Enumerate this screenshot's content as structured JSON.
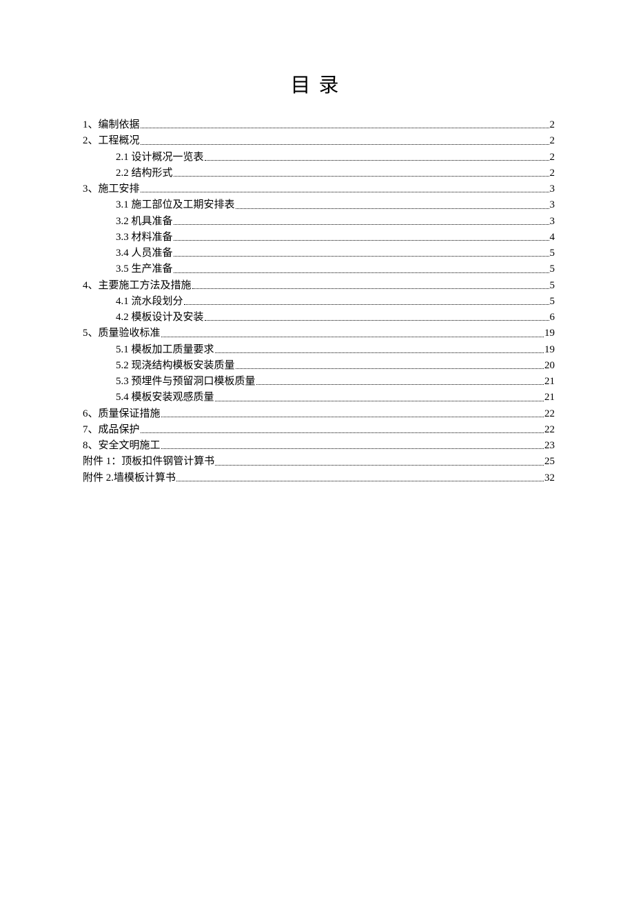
{
  "title": "目录",
  "toc": [
    {
      "level": 1,
      "label": "1、编制依据",
      "page": "2"
    },
    {
      "level": 1,
      "label": "2、工程概况",
      "page": "2"
    },
    {
      "level": 2,
      "label": "2.1 设计概况一览表",
      "page": "2"
    },
    {
      "level": 2,
      "label": "2.2 结构形式",
      "page": "2"
    },
    {
      "level": 1,
      "label": "3、施工安排",
      "page": "3"
    },
    {
      "level": 2,
      "label": "3.1 施工部位及工期安排表",
      "page": "3"
    },
    {
      "level": 2,
      "label": "3.2 机具准备",
      "page": "3"
    },
    {
      "level": 2,
      "label": "3.3 材料准备",
      "page": "4"
    },
    {
      "level": 2,
      "label": "3.4  人员准备",
      "page": "5"
    },
    {
      "level": 2,
      "label": "3.5 生产准备",
      "page": "5"
    },
    {
      "level": 1,
      "label": "4、主要施工方法及措施",
      "page": "5"
    },
    {
      "level": 2,
      "label": "4.1 流水段划分",
      "page": "5"
    },
    {
      "level": 2,
      "label": "4.2 模板设计及安装",
      "page": "6"
    },
    {
      "level": 1,
      "label": "5、质量验收标准",
      "page": "19"
    },
    {
      "level": 2,
      "label": "5.1 模板加工质量要求",
      "page": "19"
    },
    {
      "level": 2,
      "label": "5.2 现浇结构模板安装质量",
      "page": "20"
    },
    {
      "level": 2,
      "label": "5.3 预埋件与预留洞口模板质量",
      "page": "21"
    },
    {
      "level": 2,
      "label": "5.4 模板安装观感质量",
      "page": "21"
    },
    {
      "level": 1,
      "label": "6、质量保证措施",
      "page": "22"
    },
    {
      "level": 1,
      "label": "7、成品保护",
      "page": "22"
    },
    {
      "level": 1,
      "label": "8、安全文明施工",
      "page": "23"
    },
    {
      "level": 1,
      "label": "附件 1：顶板扣件钢管计算书",
      "page": "25"
    },
    {
      "level": 1,
      "label": "附件 2.墙模板计算书",
      "page": "32"
    }
  ]
}
